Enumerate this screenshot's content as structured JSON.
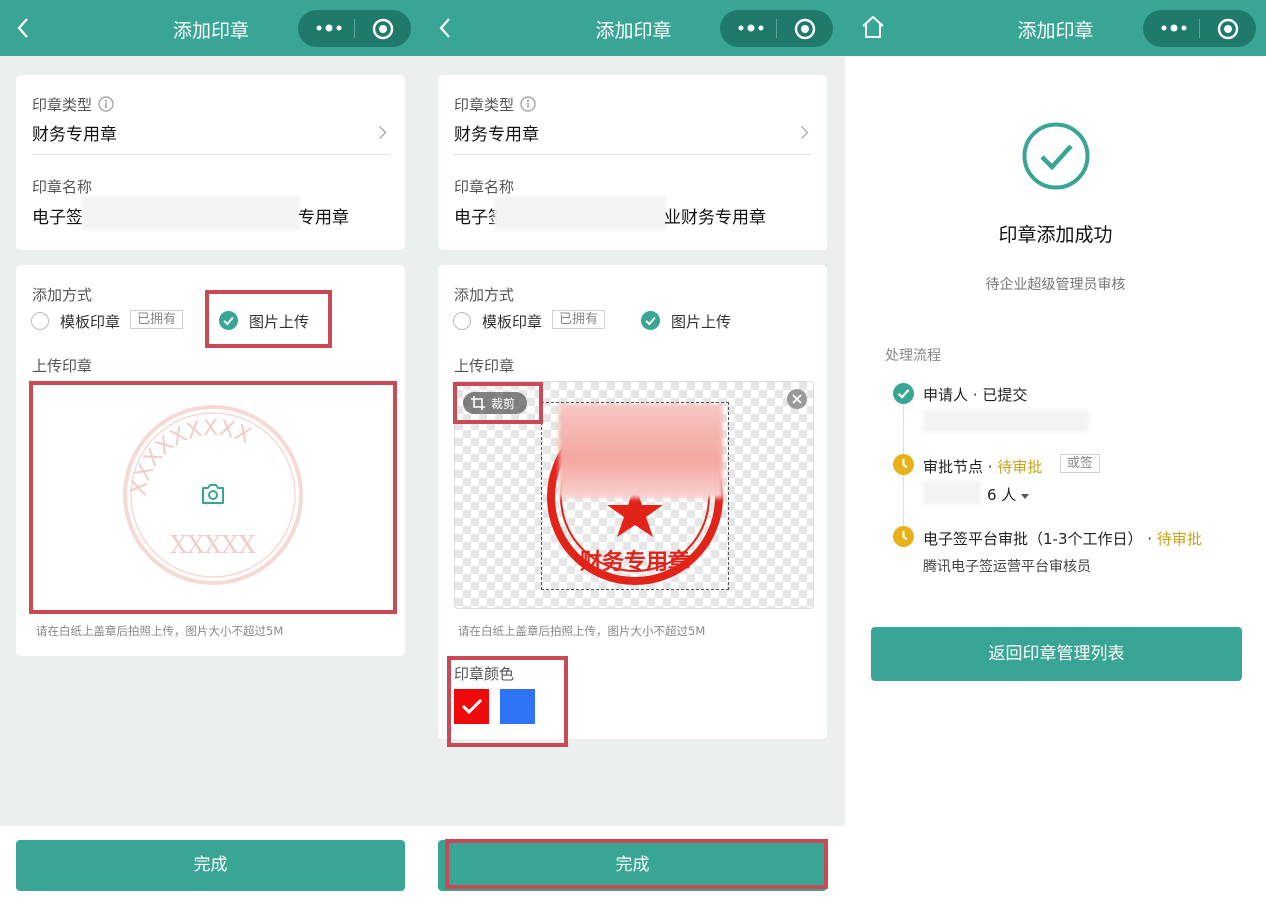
{
  "app": {
    "title": "添加印章"
  },
  "form": {
    "seal_type_label": "印章类型",
    "seal_type_value": "财务专用章",
    "seal_name_label": "印章名称",
    "seal_name_prefix_1": "电子签",
    "seal_name_suffix_1": "专用章",
    "seal_name_prefix_2": "电子签",
    "seal_name_suffix_2": "业财务专用章",
    "add_method_label": "添加方式",
    "option_template": "模板印章",
    "option_template_tag": "已拥有",
    "option_upload": "图片上传",
    "upload_label": "上传印章",
    "upload_hint": "请在白纸上盖章后拍照上传，图片大小不超过5M",
    "crop_label": "裁剪",
    "placeholder_ring_text": "XXXXXXXXX",
    "placeholder_bottom_text": "XXXXX",
    "seal_preview_text": "财务专用章",
    "seal_color_label": "印章颜色",
    "seal_colors": [
      "#ee0a0a",
      "#2f74f5"
    ],
    "selected_color_index": 0,
    "done_button": "完成"
  },
  "result": {
    "success_title": "印章添加成功",
    "success_sub": "待企业超级管理员审核",
    "process_label": "处理流程",
    "steps": [
      {
        "title": "申请人",
        "status": "已提交"
      },
      {
        "title": "审批节点",
        "status": "待审批",
        "tag": "或签",
        "count_text": "6 人"
      },
      {
        "title": "电子签平台审批（1-3个工作日）",
        "status": "待审批",
        "sub": "腾讯电子签运营平台审核员"
      }
    ],
    "back_button": "返回印章管理列表"
  },
  "colors": {
    "brand": "#39a594",
    "pending": "#e8b11a",
    "highlight_box": "#c94a55",
    "seal_red": "#e2231a"
  }
}
